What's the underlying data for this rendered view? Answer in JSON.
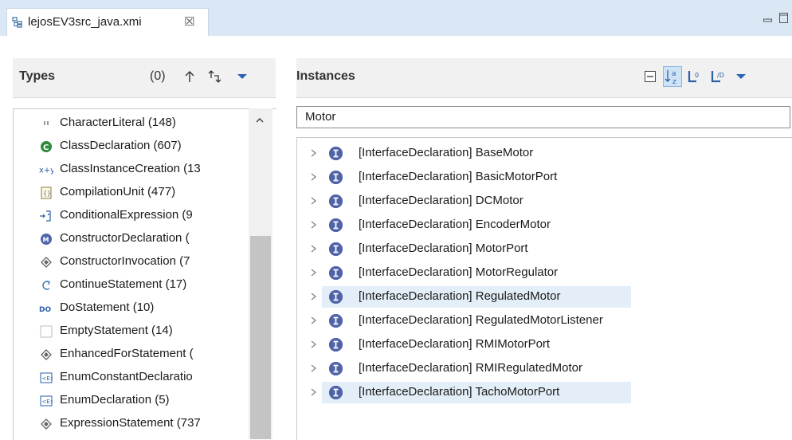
{
  "tab": {
    "title": "lejosEV3src_java.xmi",
    "close": "☒"
  },
  "window": {
    "minimize": "▭",
    "maximize": "◻"
  },
  "types_pane": {
    "title": "Types",
    "count": "(0)"
  },
  "instances_pane": {
    "title": "Instances",
    "filter_value": "Motor"
  },
  "types": [
    {
      "icon": "char-literal-icon",
      "label": "CharacterLiteral (148)"
    },
    {
      "icon": "class-icon",
      "label": "ClassDeclaration (607)"
    },
    {
      "icon": "instance-creation-icon",
      "label": "ClassInstanceCreation (13"
    },
    {
      "icon": "compilation-unit-icon",
      "label": "CompilationUnit (477)"
    },
    {
      "icon": "conditional-icon",
      "label": "ConditionalExpression (9"
    },
    {
      "icon": "constructor-icon",
      "label": "ConstructorDeclaration ("
    },
    {
      "icon": "diamond-icon",
      "label": "ConstructorInvocation (7"
    },
    {
      "icon": "continue-icon",
      "label": "ContinueStatement (17)"
    },
    {
      "icon": "do-icon",
      "label": "DoStatement (10)"
    },
    {
      "icon": "empty-icon",
      "label": "EmptyStatement (14)"
    },
    {
      "icon": "diamond-icon",
      "label": "EnhancedForStatement ("
    },
    {
      "icon": "enum-icon",
      "label": "EnumConstantDeclaratio"
    },
    {
      "icon": "enum-icon",
      "label": "EnumDeclaration (5)"
    },
    {
      "icon": "diamond-icon",
      "label": "ExpressionStatement (737"
    }
  ],
  "instances": [
    {
      "label": "[InterfaceDeclaration] BaseMotor",
      "selected": false
    },
    {
      "label": "[InterfaceDeclaration] BasicMotorPort",
      "selected": false
    },
    {
      "label": "[InterfaceDeclaration] DCMotor",
      "selected": false
    },
    {
      "label": "[InterfaceDeclaration] EncoderMotor",
      "selected": false
    },
    {
      "label": "[InterfaceDeclaration] MotorPort",
      "selected": false
    },
    {
      "label": "[InterfaceDeclaration] MotorRegulator",
      "selected": false
    },
    {
      "label": "[InterfaceDeclaration] RegulatedMotor",
      "selected": true
    },
    {
      "label": "[InterfaceDeclaration] RegulatedMotorListener",
      "selected": false
    },
    {
      "label": "[InterfaceDeclaration] RMIMotorPort",
      "selected": false
    },
    {
      "label": "[InterfaceDeclaration] RMIRegulatedMotor",
      "selected": false
    },
    {
      "label": "[InterfaceDeclaration] TachoMotorPort",
      "selected": true
    }
  ],
  "colors": {
    "accent": "#1f6fc4",
    "selection": "#e3eef9",
    "interface_icon": "#4e63a8",
    "class_icon": "#2e8b3c"
  }
}
